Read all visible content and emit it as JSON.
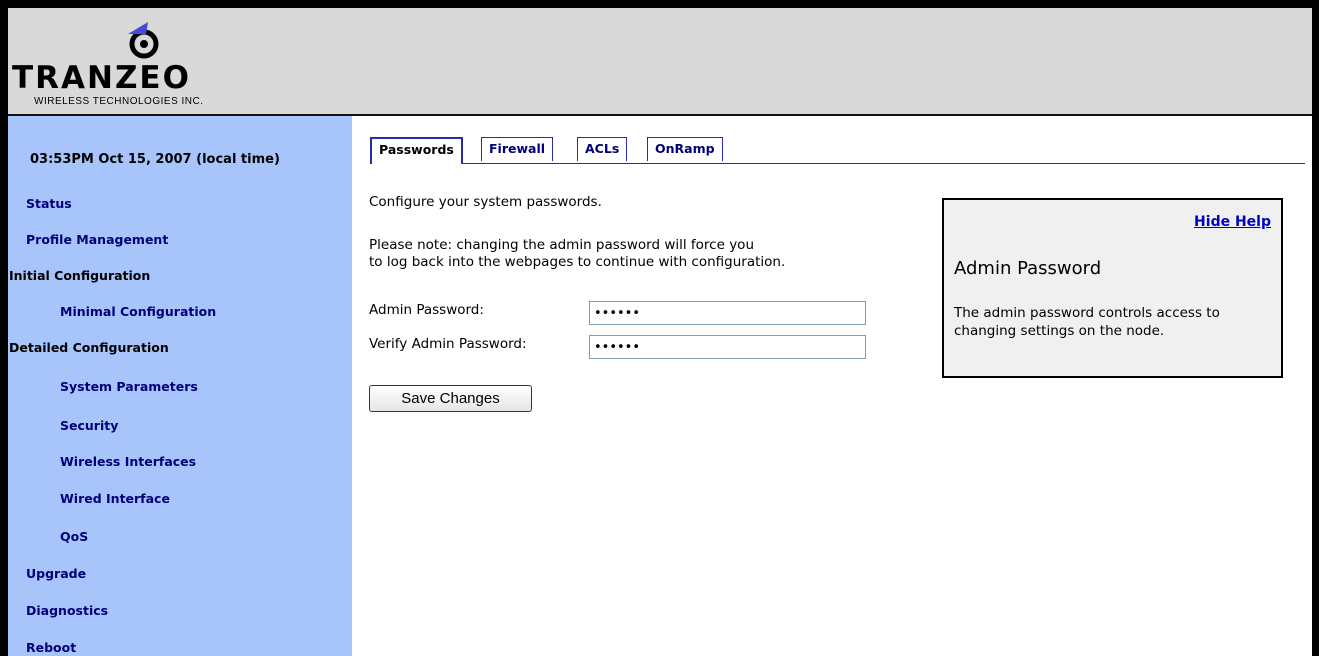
{
  "brand": {
    "name": "TRANZEO",
    "tagline": "WIRELESS TECHNOLOGIES INC.",
    "accent_color": "#4a4ad8"
  },
  "sidebar": {
    "timestamp": "03:53PM Oct 15, 2007 (local time)",
    "items": [
      {
        "label": "Status",
        "type": "link"
      },
      {
        "label": "Profile Management",
        "type": "link"
      },
      {
        "label": "Initial Configuration",
        "type": "heading"
      },
      {
        "label": "Minimal Configuration",
        "type": "sublink"
      },
      {
        "label": "Detailed Configuration",
        "type": "heading"
      },
      {
        "label": "System Parameters",
        "type": "sublink"
      },
      {
        "label": "Security",
        "type": "sublink"
      },
      {
        "label": "Wireless Interfaces",
        "type": "sublink"
      },
      {
        "label": "Wired Interface",
        "type": "sublink"
      },
      {
        "label": "QoS",
        "type": "sublink"
      },
      {
        "label": "Upgrade",
        "type": "link"
      },
      {
        "label": "Diagnostics",
        "type": "link"
      },
      {
        "label": "Reboot",
        "type": "link"
      }
    ]
  },
  "tabs": [
    {
      "label": "Passwords",
      "active": true
    },
    {
      "label": "Firewall",
      "active": false
    },
    {
      "label": "ACLs",
      "active": false
    },
    {
      "label": "OnRamp",
      "active": false
    }
  ],
  "main": {
    "intro": "Configure your system passwords.",
    "note_line1": "Please note: changing the admin password will force you",
    "note_line2": "to log back into the webpages to continue with configuration.",
    "admin_password_label": "Admin Password:",
    "admin_password_value": "••••••",
    "verify_password_label": "Verify Admin Password:",
    "verify_password_value": "••••••",
    "save_label": "Save Changes"
  },
  "help": {
    "hide_label": "Hide Help",
    "title": "Admin Password",
    "body": "The admin password controls access to changing settings on the node."
  }
}
